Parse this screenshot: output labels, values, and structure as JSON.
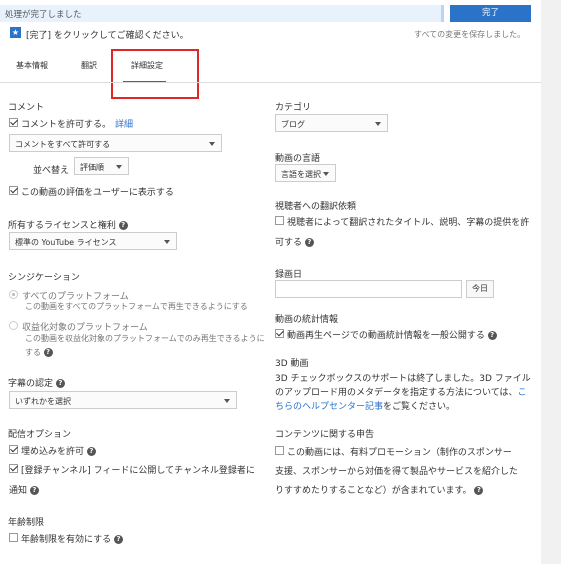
{
  "status_bar": {
    "message": "処理が完了しました",
    "done_label": "完了"
  },
  "notice": {
    "instruction": "[完了] をクリックしてご確認ください。",
    "saved": "すべての変更を保存しました。"
  },
  "tabs": [
    {
      "label": "基本情報"
    },
    {
      "label": "翻訳"
    },
    {
      "label": "詳細設定"
    }
  ],
  "comments": {
    "title": "コメント",
    "allow_label": "コメントを許可する。",
    "details_link": "詳細",
    "allow_select": "コメントをすべて許可する",
    "sort_label": "並べ替え",
    "sort_select": "評価順",
    "show_ratings_label": "この動画の評価をユーザーに表示する"
  },
  "license": {
    "title": "所有するライセンスと権利",
    "select": "標準の YouTube ライセンス"
  },
  "syndication": {
    "title": "シンジケーション",
    "opt1_label": "すべてのプラットフォーム",
    "opt1_desc": "この動画をすべてのプラットフォームで再生できるようにする",
    "opt2_label": "収益化対象のプラットフォーム",
    "opt2_desc1": "この動画を収益化対象のプラットフォームでのみ再生できるように",
    "opt2_desc2": "する"
  },
  "captions": {
    "title": "字幕の認定",
    "select": "いずれかを選択"
  },
  "distribution": {
    "title": "配信オプション",
    "embed_label": "埋め込みを許可",
    "notify_label1": "[登録チャンネル] フィードに公開してチャンネル登録者に",
    "notify_label2": "通知"
  },
  "age": {
    "title": "年齢制限",
    "enable_label": "年齢制限を有効にする"
  },
  "category": {
    "title": "カテゴリ",
    "select": "ブログ"
  },
  "language": {
    "title": "動画の言語",
    "select": "言語を選択"
  },
  "translation": {
    "title": "視聴者への翻訳依頼",
    "label1": "視聴者によって翻訳されたタイトル、説明、字幕の提供を許",
    "label2": "可する"
  },
  "recording": {
    "title": "録画日",
    "today_label": "今日"
  },
  "stats": {
    "title": "動画の統計情報",
    "label": "動画再生ページでの動画統計情報を一般公開する"
  },
  "threed": {
    "title": "3D 動画",
    "line1": "3D チェックボックスのサポートは終了しました。3D ファイル",
    "line2a": "のアップロード用のメタデータを指定する方法については、",
    "line2b": "こ",
    "line3a": "ちらのヘルプセンター記事",
    "line3b": "をご覧ください。"
  },
  "content": {
    "title": "コンテンツに関する申告",
    "line1": "この動画には、有料プロモーション（制作のスポンサー",
    "line2": "支援、スポンサーから対価を得て製品やサービスを紹介した",
    "line3": "りすすめたりすることなど）が含まれています。"
  }
}
